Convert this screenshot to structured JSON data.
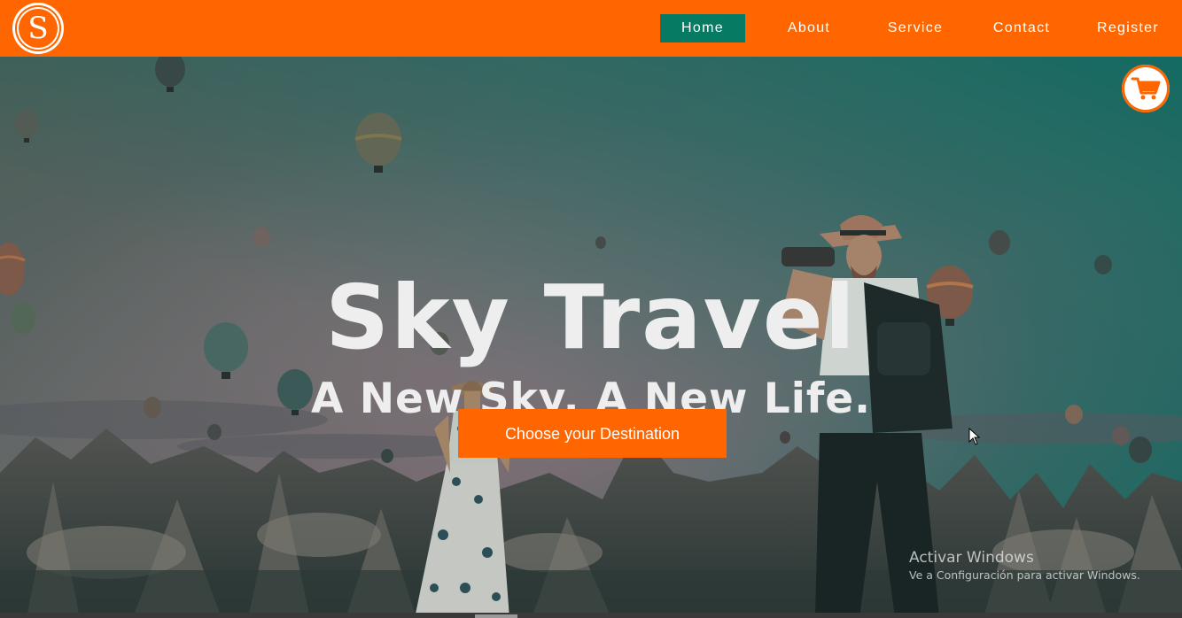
{
  "brand": {
    "logo_letter": "S"
  },
  "nav": {
    "items": [
      {
        "label": "Home",
        "active": true
      },
      {
        "label": "About",
        "active": false
      },
      {
        "label": "Service",
        "active": false
      },
      {
        "label": "Contact",
        "active": false
      },
      {
        "label": "Register",
        "active": false
      }
    ]
  },
  "hero": {
    "title": "Sky Travel",
    "subtitle": "A New Sky, A New Life.",
    "cta_label": "Choose your Destination"
  },
  "cart": {
    "icon": "shopping-cart-icon"
  },
  "watermark": {
    "title": "Activar Windows",
    "subtitle": "Ve a Configuración para activar Windows."
  },
  "colors": {
    "accent": "#ff6600",
    "nav_active": "#067a63",
    "text_light": "#eeeeee"
  }
}
